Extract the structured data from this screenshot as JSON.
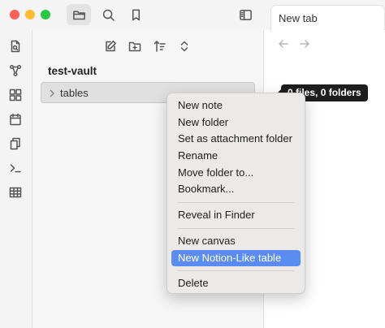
{
  "sidebar": {
    "vault_name": "test-vault",
    "folder": {
      "label": "tables"
    }
  },
  "main": {
    "tab": {
      "label": "New tab"
    }
  },
  "tooltip": {
    "text": "0 files, 0 folders"
  },
  "context_menu": {
    "highlighted": "New Notion-Like table",
    "groups": [
      [
        "New note",
        "New folder",
        "Set as attachment folder",
        "Rename",
        "Move folder to...",
        "Bookmark..."
      ],
      [
        "Reveal in Finder"
      ],
      [
        "New canvas",
        "New Notion-Like table"
      ],
      [
        "Delete"
      ]
    ]
  },
  "colors": {
    "highlight": "#5b8cf2",
    "traffic_red": "#fe5f57",
    "traffic_yellow": "#febc2e",
    "traffic_green": "#28c840"
  },
  "icons": {
    "titlebar": [
      "folder-icon",
      "search-icon",
      "bookmark-icon",
      "sidebar-toggle-icon"
    ],
    "ribbon": [
      "file-switcher-icon",
      "graph-view-icon",
      "canvas-icon",
      "calendar-icon",
      "templates-icon",
      "terminal-icon",
      "table-icon"
    ],
    "explorer_nav": [
      "new-note-icon",
      "new-folder-icon",
      "sort-icon",
      "collapse-expand-icon"
    ],
    "tab_nav": [
      "back-arrow-icon",
      "forward-arrow-icon"
    ]
  }
}
